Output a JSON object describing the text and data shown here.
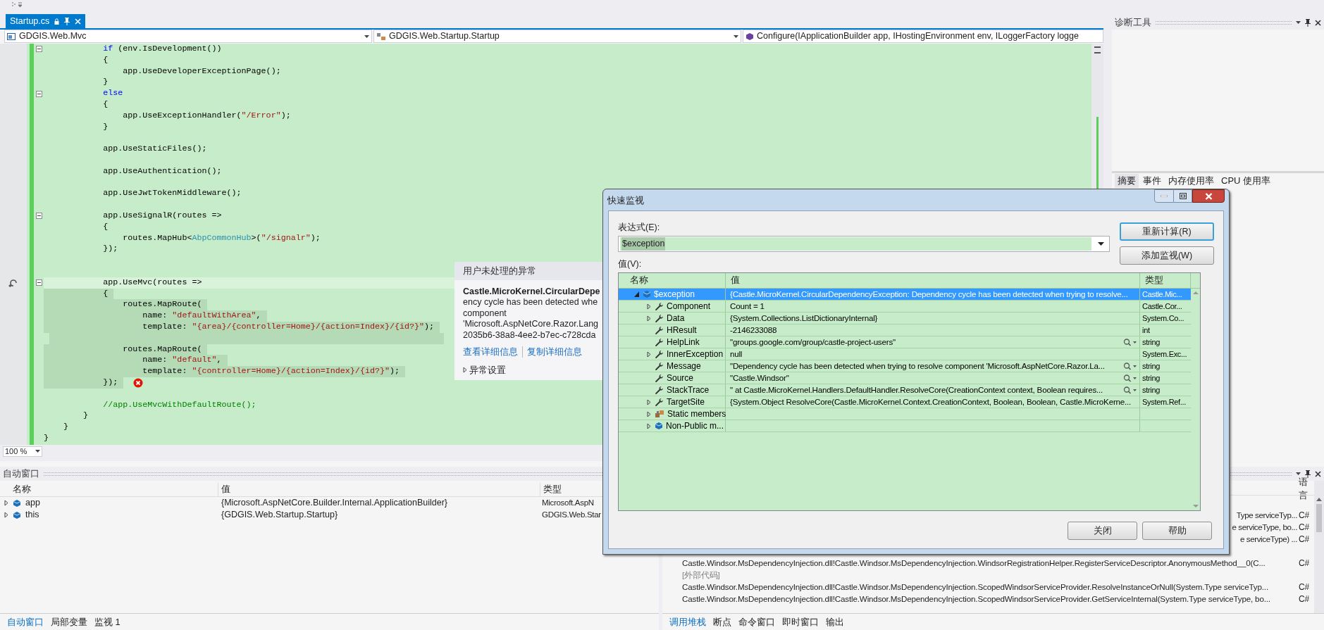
{
  "editor": {
    "tab": {
      "label": "Startup.cs",
      "selected": true
    },
    "navigation": [
      "GDGIS.Web.Mvc",
      "GDGIS.Web.Startup.Startup",
      "Configure(IApplicationBuilder app, IHostingEnvironment env, ILoggerFactory logge"
    ],
    "lines": [
      {
        "tokens": [
          {
            "t": "            if",
            "kind": "keyword"
          },
          {
            "t": " (env.IsDevelopment())",
            "kind": "plain"
          }
        ],
        "kind": "normal",
        "error": false,
        "fold": true
      },
      {
        "tokens": [
          {
            "t": "            {",
            "kind": "plain"
          }
        ],
        "kind": "normal",
        "error": false,
        "fold": false
      },
      {
        "tokens": [
          {
            "t": "                app.UseDeveloperExceptionPage();",
            "kind": "plain"
          }
        ],
        "kind": "normal",
        "error": false,
        "fold": false
      },
      {
        "tokens": [
          {
            "t": "            }",
            "kind": "plain"
          }
        ],
        "kind": "normal",
        "error": false,
        "fold": false
      },
      {
        "tokens": [
          {
            "t": "            else",
            "kind": "keyword"
          }
        ],
        "kind": "normal",
        "error": false,
        "fold": true
      },
      {
        "tokens": [
          {
            "t": "            {",
            "kind": "plain"
          }
        ],
        "kind": "normal",
        "error": false,
        "fold": false
      },
      {
        "tokens": [
          {
            "t": "                app.UseExceptionHandler(",
            "kind": "plain"
          },
          {
            "t": "\"/Error\"",
            "kind": "string"
          },
          {
            "t": ");",
            "kind": "plain"
          }
        ],
        "kind": "normal",
        "error": false,
        "fold": false
      },
      {
        "tokens": [
          {
            "t": "            }",
            "kind": "plain"
          }
        ],
        "kind": "normal",
        "error": false,
        "fold": false
      },
      {
        "kind": "normal",
        "error": false,
        "fold": false
      },
      {
        "tokens": [
          {
            "t": "            app.UseStaticFiles();",
            "kind": "plain"
          }
        ],
        "kind": "normal",
        "error": false,
        "fold": false
      },
      {
        "kind": "normal",
        "error": false,
        "fold": false
      },
      {
        "tokens": [
          {
            "t": "            app.UseAuthentication();",
            "kind": "plain"
          }
        ],
        "kind": "normal",
        "error": false,
        "fold": false
      },
      {
        "kind": "normal",
        "error": false,
        "fold": false
      },
      {
        "tokens": [
          {
            "t": "            app.UseJwtTokenMiddleware();",
            "kind": "plain"
          }
        ],
        "kind": "normal",
        "error": false,
        "fold": false
      },
      {
        "kind": "normal",
        "error": false,
        "fold": false
      },
      {
        "tokens": [
          {
            "t": "            app.UseSignalR(routes =>",
            "kind": "plain"
          }
        ],
        "kind": "normal",
        "error": false,
        "fold": true
      },
      {
        "tokens": [
          {
            "t": "            {",
            "kind": "plain"
          }
        ],
        "kind": "normal",
        "error": false,
        "fold": false
      },
      {
        "tokens": [
          {
            "t": "                routes.MapHub<",
            "kind": "plain"
          },
          {
            "t": "AbpCommonHub",
            "kind": "type"
          },
          {
            "t": ">(",
            "kind": "plain"
          },
          {
            "t": "\"/signalr\"",
            "kind": "string"
          },
          {
            "t": ");",
            "kind": "plain"
          }
        ],
        "kind": "normal",
        "error": false,
        "fold": false
      },
      {
        "tokens": [
          {
            "t": "            });",
            "kind": "plain"
          }
        ],
        "kind": "normal",
        "error": false,
        "fold": false
      },
      {
        "kind": "normal",
        "error": false,
        "fold": false
      },
      {
        "kind": "normal",
        "error": false,
        "fold": false
      },
      {
        "tokens": [
          {
            "t": "            app.UseMvc(routes =>",
            "kind": "plain"
          }
        ],
        "kind": "current",
        "error": false,
        "fold": true
      },
      {
        "tokens": [
          {
            "t": "            {",
            "kind": "plain"
          }
        ],
        "kind": "range",
        "error": false,
        "fold": false
      },
      {
        "tokens": [
          {
            "t": "                routes.MapRoute(",
            "kind": "plain"
          }
        ],
        "kind": "range",
        "error": false,
        "fold": false
      },
      {
        "tokens": [
          {
            "t": "                    name: ",
            "kind": "plain"
          },
          {
            "t": "\"defaultWithArea\"",
            "kind": "string"
          },
          {
            "t": ",",
            "kind": "plain"
          }
        ],
        "kind": "range",
        "error": false,
        "fold": false
      },
      {
        "tokens": [
          {
            "t": "                    template: ",
            "kind": "plain"
          },
          {
            "t": "\"{area}/{controller=Home}/{action=Index}/{id?}\"",
            "kind": "string"
          },
          {
            "t": ");",
            "kind": "plain"
          }
        ],
        "kind": "range",
        "error": false,
        "fold": false
      },
      {
        "kind": "range",
        "error": false,
        "fold": false
      },
      {
        "tokens": [
          {
            "t": "                routes.MapRoute(",
            "kind": "plain"
          }
        ],
        "kind": "range",
        "error": false,
        "fold": false
      },
      {
        "tokens": [
          {
            "t": "                    name: ",
            "kind": "plain"
          },
          {
            "t": "\"default\"",
            "kind": "string"
          },
          {
            "t": ",",
            "kind": "plain"
          }
        ],
        "kind": "range",
        "error": false,
        "fold": false
      },
      {
        "tokens": [
          {
            "t": "                    template: ",
            "kind": "plain"
          },
          {
            "t": "\"{controller=Home}/{action=Index}/{id?}\"",
            "kind": "string"
          },
          {
            "t": ");",
            "kind": "plain"
          }
        ],
        "kind": "range",
        "error": false,
        "fold": false
      },
      {
        "tokens": [
          {
            "t": "            });",
            "kind": "plain"
          }
        ],
        "kind": "range",
        "error": true,
        "fold": false
      },
      {
        "kind": "normal",
        "error": false,
        "fold": false
      },
      {
        "tokens": [
          {
            "t": "            //app.UseMvcWithDefaultRoute();",
            "kind": "comment"
          }
        ],
        "kind": "normal",
        "error": false,
        "fold": false
      },
      {
        "tokens": [
          {
            "t": "        }",
            "kind": "plain"
          }
        ],
        "kind": "normal",
        "error": false,
        "fold": false
      },
      {
        "tokens": [
          {
            "t": "    }",
            "kind": "plain"
          }
        ],
        "kind": "normal",
        "error": false,
        "fold": false
      },
      {
        "tokens": [
          {
            "t": "}",
            "kind": "plain"
          }
        ],
        "kind": "normal",
        "error": false,
        "fold": false
      }
    ],
    "zoom": "100 %"
  },
  "exception_popup": {
    "title": "用户未处理的异常",
    "exception_type": "Castle.MicroKernel.CircularDepe",
    "message_lines": [
      "ency cycle has been detected whe",
      "component",
      "'Microsoft.AspNetCore.Razor.Lang",
      "2035b6-38a8-4ee2-b7ec-c728cda"
    ],
    "links": [
      "查看详细信息",
      "复制详细信息"
    ],
    "settings": {
      "label": "异常设置",
      "expanded": false
    }
  },
  "diagnostics": {
    "title": "诊断工具",
    "tabs": [
      {
        "label": "摘要",
        "selected": true
      },
      {
        "label": "事件",
        "selected": false
      },
      {
        "label": "内存使用率",
        "selected": false
      },
      {
        "label": "CPU 使用率",
        "selected": false
      }
    ]
  },
  "autos": {
    "title": "自动窗口",
    "columns": [
      "名称",
      "值",
      "类型"
    ],
    "rows": [
      {
        "name": "app",
        "value": "{Microsoft.AspNetCore.Builder.Internal.ApplicationBuilder}",
        "type": "Microsoft.AspN",
        "expanded": false
      },
      {
        "name": "this",
        "value": "{GDGIS.Web.Startup.Startup}",
        "type": "GDGIS.Web.Star",
        "expanded": false
      }
    ],
    "tabs": [
      {
        "label": "自动窗口",
        "selected": true
      },
      {
        "label": "局部变量",
        "selected": false
      },
      {
        "label": "监视 1",
        "selected": false
      }
    ]
  },
  "call_stack": {
    "column": "语言",
    "rows": [
      {
        "kind": "partial",
        "text": "Type serviceTyp...",
        "language": "C#"
      },
      {
        "kind": "partial",
        "text": "e serviceType, bo...",
        "language": "C#"
      },
      {
        "kind": "partial",
        "text": "e serviceType) ...",
        "language": "C#"
      },
      {
        "kind": "frame",
        "text": "Castle.Windsor.MsDependencyInjection.dll!Castle.Windsor.MsDependencyInjection.WindsorRegistrationHelper.RegisterServiceDescriptor.AnonymousMethod__0(C...",
        "language": "C#"
      },
      {
        "kind": "external",
        "text": "[外部代码]"
      },
      {
        "kind": "frame",
        "text": "Castle.Windsor.MsDependencyInjection.dll!Castle.Windsor.MsDependencyInjection.ScopedWindsorServiceProvider.ResolveInstanceOrNull(System.Type serviceTyp...",
        "language": "C#"
      },
      {
        "kind": "frame",
        "text": "Castle.Windsor.MsDependencyInjection.dll!Castle.Windsor.MsDependencyInjection.ScopedWindsorServiceProvider.GetServiceInternal(System.Type serviceType, bo...",
        "language": "C#"
      }
    ],
    "tabs": [
      {
        "label": "调用堆栈",
        "selected": true
      },
      {
        "label": "断点",
        "selected": false
      },
      {
        "label": "命令窗口",
        "selected": false
      },
      {
        "label": "即时窗口",
        "selected": false
      },
      {
        "label": "输出",
        "selected": false
      }
    ]
  },
  "quick_watch": {
    "title": "快速监视",
    "expression_label": "表达式(E):",
    "expression": "$exception",
    "value_label": "值(V):",
    "buttons": [
      "重新计算(R)",
      "添加监视(W)"
    ],
    "columns": [
      "名称",
      "值",
      "类型"
    ],
    "rows": [
      {
        "name": "$exception",
        "value": "{Castle.MicroKernel.CircularDependencyException: Dependency cycle has been detected when trying to resolve...",
        "type": "Castle.Mic...",
        "kind": "object",
        "expandable": true,
        "expanded": true,
        "viewer": false,
        "selected": true,
        "children": [
          {
            "name": "Component",
            "value": "Count = 1",
            "type": "Castle.Cor...",
            "kind": "property",
            "expandable": true,
            "expanded": false,
            "viewer": false,
            "selected": false
          },
          {
            "name": "Data",
            "value": "{System.Collections.ListDictionaryInternal}",
            "type": "System.Co...",
            "kind": "property",
            "expandable": true,
            "expanded": false,
            "viewer": false,
            "selected": false
          },
          {
            "name": "HResult",
            "value": "-2146233088",
            "type": "int",
            "kind": "property",
            "expandable": false,
            "expanded": false,
            "viewer": false,
            "selected": false
          },
          {
            "name": "HelpLink",
            "value": "\"groups.google.com/group/castle-project-users\"",
            "type": "string",
            "kind": "property",
            "expandable": false,
            "expanded": false,
            "viewer": true,
            "selected": false
          },
          {
            "name": "InnerException",
            "value": "null",
            "type": "System.Exc...",
            "kind": "property",
            "expandable": true,
            "expanded": false,
            "viewer": false,
            "selected": false
          },
          {
            "name": "Message",
            "value": "\"Dependency cycle has been detected when trying to resolve component 'Microsoft.AspNetCore.Razor.La...",
            "type": "string",
            "kind": "property",
            "expandable": false,
            "expanded": false,
            "viewer": true,
            "selected": false
          },
          {
            "name": "Source",
            "value": "\"Castle.Windsor\"",
            "type": "string",
            "kind": "property",
            "expandable": false,
            "expanded": false,
            "viewer": true,
            "selected": false
          },
          {
            "name": "StackTrace",
            "value": "\"   at Castle.MicroKernel.Handlers.DefaultHandler.ResolveCore(CreationContext context, Boolean requires...",
            "type": "string",
            "kind": "property",
            "expandable": false,
            "expanded": false,
            "viewer": true,
            "selected": false
          },
          {
            "name": "TargetSite",
            "value": "{System.Object ResolveCore(Castle.MicroKernel.Context.CreationContext, Boolean, Boolean, Castle.MicroKerne...",
            "type": "System.Ref...",
            "kind": "property",
            "expandable": true,
            "expanded": false,
            "viewer": false,
            "selected": false
          },
          {
            "name": "Static members",
            "kind": "static",
            "expandable": true,
            "expanded": false,
            "viewer": false,
            "selected": false
          },
          {
            "name": "Non-Public m...",
            "kind": "object",
            "expandable": true,
            "expanded": false,
            "viewer": false,
            "selected": false
          }
        ]
      }
    ],
    "footer_buttons": [
      "关闭",
      "帮助"
    ]
  }
}
